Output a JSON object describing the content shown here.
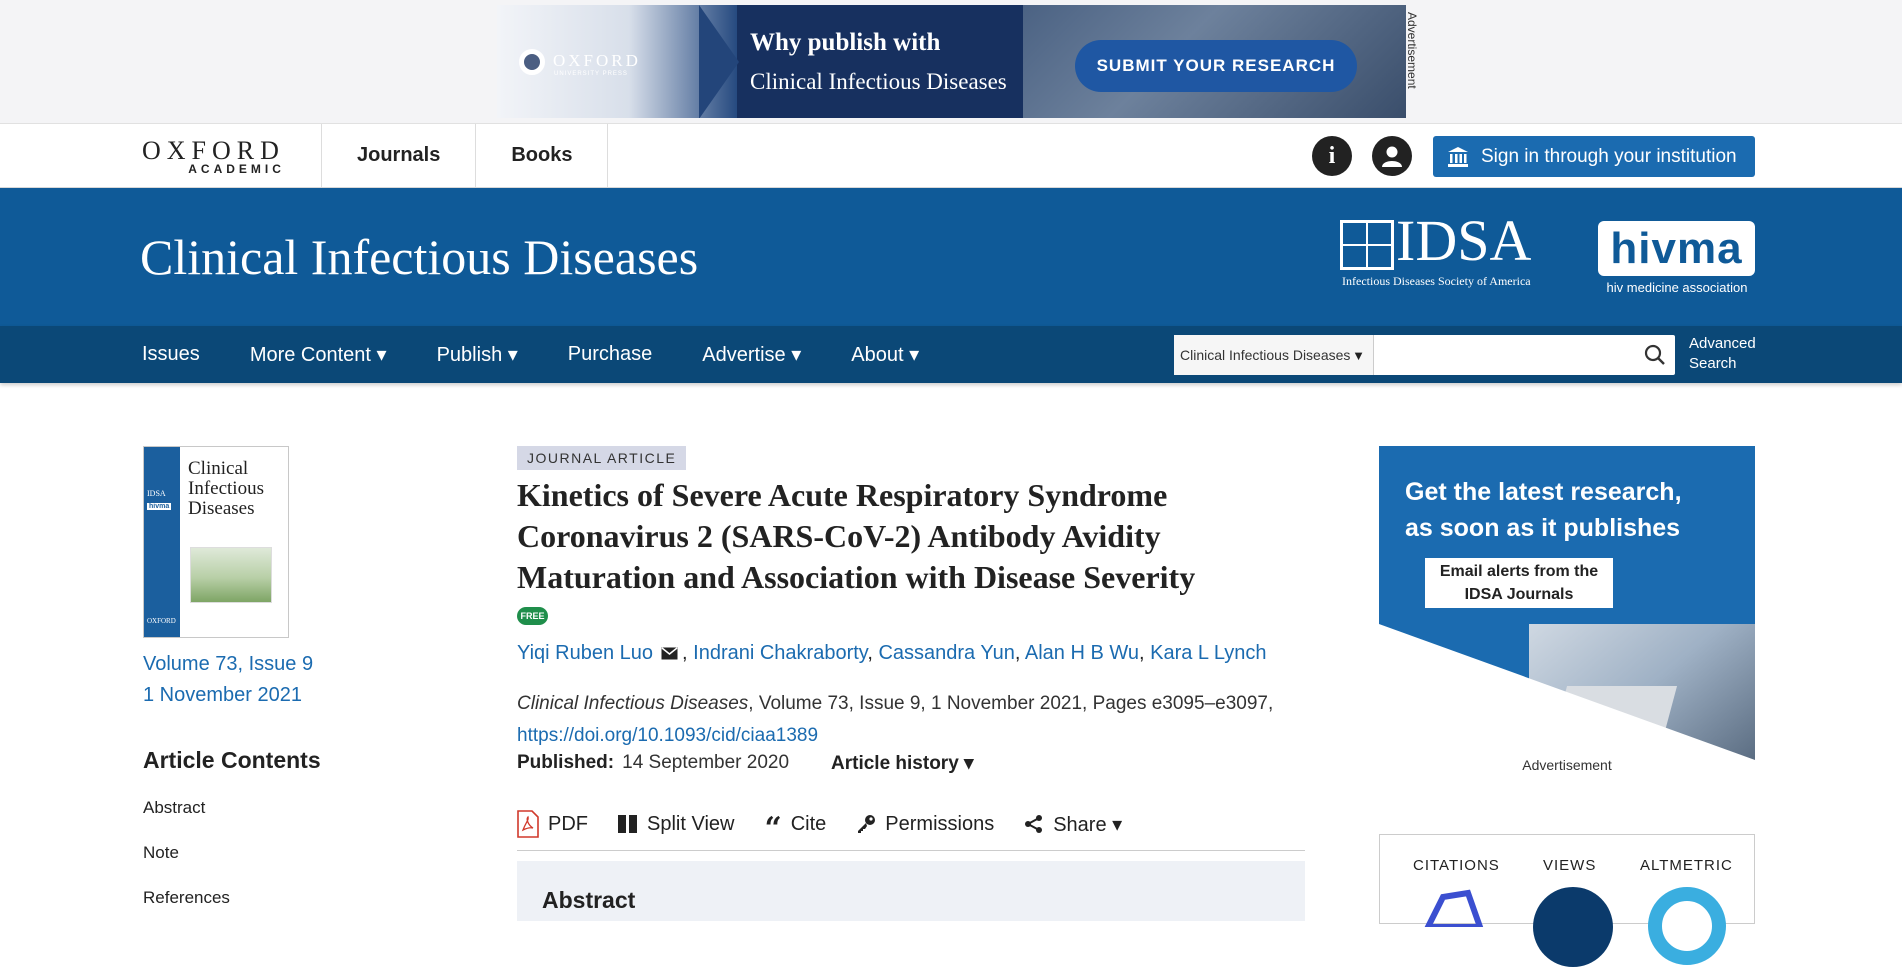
{
  "ad_top": {
    "brand": "OXFORD",
    "brand_sub": "UNIVERSITY PRESS",
    "headline": "Why publish with",
    "subline": "Clinical Infectious Diseases",
    "cta": "SUBMIT YOUR RESEARCH",
    "side_label": "Advertisement"
  },
  "global_header": {
    "logo_main": "OXFORD",
    "logo_sub": "ACADEMIC",
    "nav": [
      "Journals",
      "Books"
    ],
    "info_icon": "info-icon",
    "account_icon": "user-icon",
    "signin_label": "Sign in through your institution"
  },
  "journal": {
    "title": "Clinical Infectious Diseases",
    "idsa_letters": "IDSA",
    "idsa_sub": "Infectious Diseases Society of America",
    "hivma_letters": "hivma",
    "hivma_sub": "hiv medicine association"
  },
  "journal_nav": {
    "items": [
      "Issues",
      "More Content ▾",
      "Publish ▾",
      "Purchase",
      "Advertise ▾",
      "About ▾"
    ],
    "search_scope": "Clinical Infectious Diseases",
    "search_value": "",
    "advanced_search": "Advanced Search"
  },
  "issue": {
    "cover_title": "Clinical Infectious Diseases",
    "cover_idsa": "IDSA",
    "cover_hivma": "hivma",
    "cover_oxford": "OXFORD",
    "volume": "Volume 73, Issue 9",
    "date": "1 November 2021"
  },
  "contents": {
    "heading": "Article Contents",
    "items": [
      "Abstract",
      "Note",
      "References"
    ]
  },
  "article": {
    "type": "JOURNAL ARTICLE",
    "title": "Kinetics of Severe Acute Respiratory Syndrome Coronavirus 2 (SARS-CoV-2) Antibody Avidity Maturation and Association with Disease Severity",
    "free_badge": "FREE",
    "authors": [
      "Yiqi Ruben Luo",
      "Indrani Chakraborty",
      "Cassandra Yun",
      "Alan H B Wu",
      "Kara L Lynch"
    ],
    "journal_italic": "Clinical Infectious Diseases",
    "citation_rest": ", Volume 73, Issue 9, 1 November 2021, Pages e3095–e3097,",
    "doi": "https://doi.org/10.1093/cid/ciaa1389",
    "published_label": "Published:",
    "published_date": "14 September 2020",
    "history_label": "Article history ▾",
    "toolbar": [
      "PDF",
      "Split View",
      "Cite",
      "Permissions",
      "Share ▾"
    ],
    "abstract_heading": "Abstract"
  },
  "right_ad": {
    "headline_1": "Get the latest research,",
    "headline_2": "as soon as it publishes",
    "alert_1": "Email alerts from the",
    "alert_2": "IDSA Journals",
    "label": "Advertisement"
  },
  "metrics": {
    "labels": [
      "CITATIONS",
      "VIEWS",
      "ALTMETRIC"
    ]
  },
  "colors": {
    "brand_blue": "#0f5a98",
    "nav_blue": "#0b4877",
    "link_blue": "#1b6bb0",
    "free_green": "#1f8e4b"
  }
}
